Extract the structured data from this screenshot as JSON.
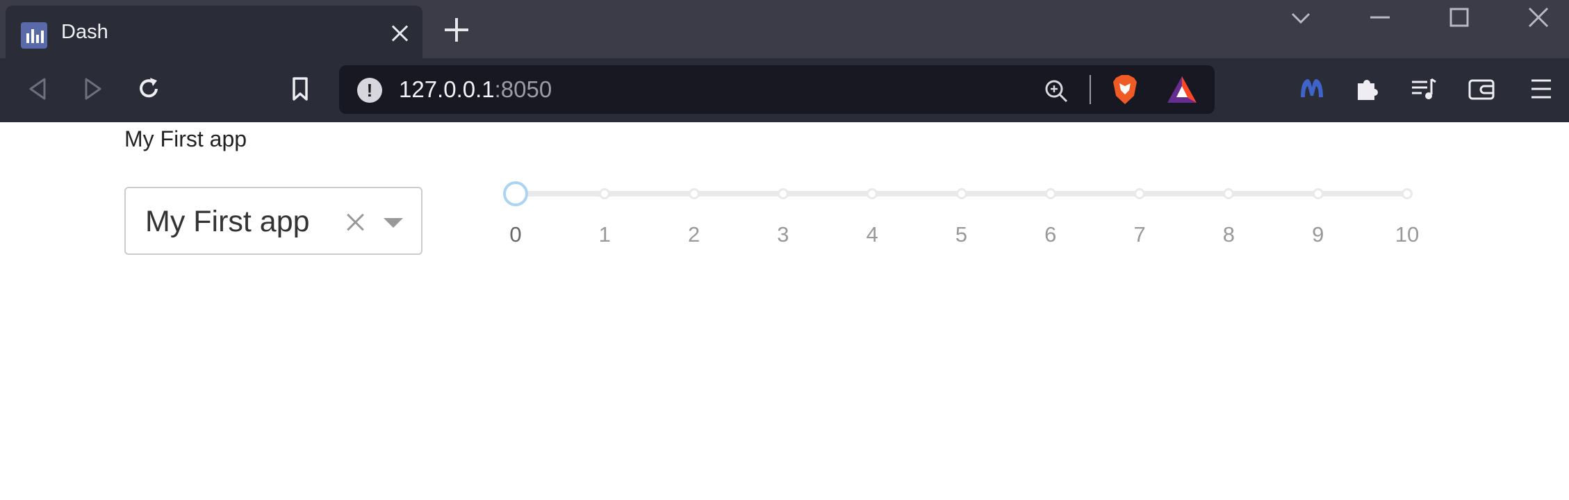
{
  "browser": {
    "tab": {
      "title": "Dash"
    },
    "url": {
      "host": "127.0.0.1",
      "port": ":8050"
    }
  },
  "app": {
    "title": "My First app",
    "dropdown": {
      "value": "My First app"
    },
    "slider": {
      "value": 0,
      "min": 0,
      "max": 10,
      "marks": [
        "0",
        "1",
        "2",
        "3",
        "4",
        "5",
        "6",
        "7",
        "8",
        "9",
        "10"
      ]
    }
  },
  "colors": {
    "tab_strip": "#3b3c48",
    "toolbar": "#2a2c38",
    "url_bar": "#171821",
    "slider_handle": "#abd3f4",
    "slider_rail": "#e9e9e9"
  }
}
